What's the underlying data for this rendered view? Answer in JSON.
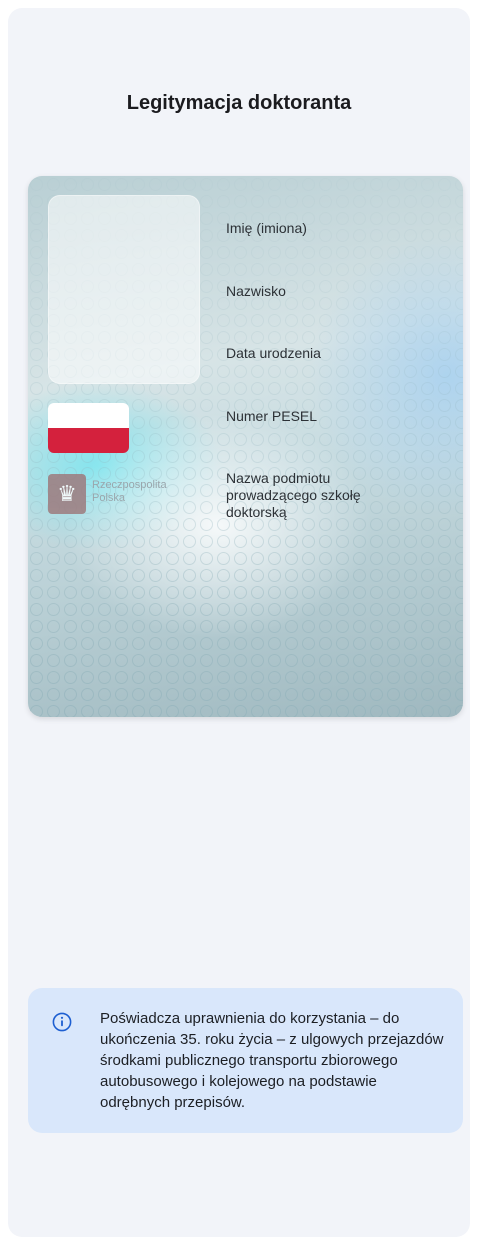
{
  "page": {
    "title": "Legitymacja doktoranta"
  },
  "card": {
    "fields": [
      "Imię (imiona)",
      "Nazwisko",
      "Data urodzenia",
      "Numer PESEL",
      "Nazwa podmiotu prowadzącego szkołę doktorską"
    ],
    "emblem_text_line1": "Rzeczpospolita",
    "emblem_text_line2": "Polska",
    "flag_colors": [
      "#ffffff",
      "#d4213d"
    ],
    "emblem_icon": "polish-eagle-icon"
  },
  "info": {
    "icon": "info-icon",
    "text": "Poświadcza uprawnienia do korzystania – do ukończenia 35. roku życia – z ulgowych przejazdów środkami publicznego transportu zbiorowego autobusowego i kolejowego na podstawie odrębnych przepisów.",
    "accent_color": "#1d5fd1"
  }
}
